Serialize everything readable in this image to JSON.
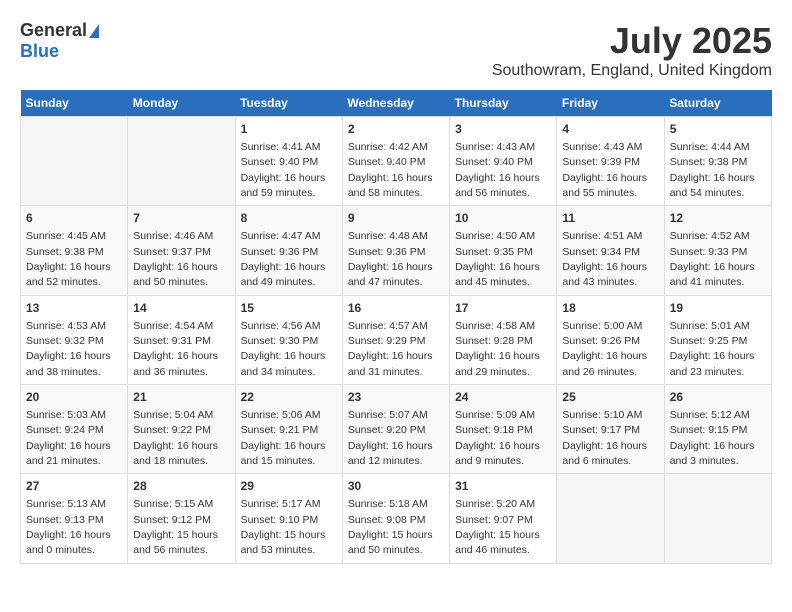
{
  "logo": {
    "general": "General",
    "blue": "Blue"
  },
  "title": "July 2025",
  "location": "Southowram, England, United Kingdom",
  "days_of_week": [
    "Sunday",
    "Monday",
    "Tuesday",
    "Wednesday",
    "Thursday",
    "Friday",
    "Saturday"
  ],
  "weeks": [
    [
      {
        "day": "",
        "info": ""
      },
      {
        "day": "",
        "info": ""
      },
      {
        "day": "1",
        "info": "Sunrise: 4:41 AM\nSunset: 9:40 PM\nDaylight: 16 hours and 59 minutes."
      },
      {
        "day": "2",
        "info": "Sunrise: 4:42 AM\nSunset: 9:40 PM\nDaylight: 16 hours and 58 minutes."
      },
      {
        "day": "3",
        "info": "Sunrise: 4:43 AM\nSunset: 9:40 PM\nDaylight: 16 hours and 56 minutes."
      },
      {
        "day": "4",
        "info": "Sunrise: 4:43 AM\nSunset: 9:39 PM\nDaylight: 16 hours and 55 minutes."
      },
      {
        "day": "5",
        "info": "Sunrise: 4:44 AM\nSunset: 9:38 PM\nDaylight: 16 hours and 54 minutes."
      }
    ],
    [
      {
        "day": "6",
        "info": "Sunrise: 4:45 AM\nSunset: 9:38 PM\nDaylight: 16 hours and 52 minutes."
      },
      {
        "day": "7",
        "info": "Sunrise: 4:46 AM\nSunset: 9:37 PM\nDaylight: 16 hours and 50 minutes."
      },
      {
        "day": "8",
        "info": "Sunrise: 4:47 AM\nSunset: 9:36 PM\nDaylight: 16 hours and 49 minutes."
      },
      {
        "day": "9",
        "info": "Sunrise: 4:48 AM\nSunset: 9:36 PM\nDaylight: 16 hours and 47 minutes."
      },
      {
        "day": "10",
        "info": "Sunrise: 4:50 AM\nSunset: 9:35 PM\nDaylight: 16 hours and 45 minutes."
      },
      {
        "day": "11",
        "info": "Sunrise: 4:51 AM\nSunset: 9:34 PM\nDaylight: 16 hours and 43 minutes."
      },
      {
        "day": "12",
        "info": "Sunrise: 4:52 AM\nSunset: 9:33 PM\nDaylight: 16 hours and 41 minutes."
      }
    ],
    [
      {
        "day": "13",
        "info": "Sunrise: 4:53 AM\nSunset: 9:32 PM\nDaylight: 16 hours and 38 minutes."
      },
      {
        "day": "14",
        "info": "Sunrise: 4:54 AM\nSunset: 9:31 PM\nDaylight: 16 hours and 36 minutes."
      },
      {
        "day": "15",
        "info": "Sunrise: 4:56 AM\nSunset: 9:30 PM\nDaylight: 16 hours and 34 minutes."
      },
      {
        "day": "16",
        "info": "Sunrise: 4:57 AM\nSunset: 9:29 PM\nDaylight: 16 hours and 31 minutes."
      },
      {
        "day": "17",
        "info": "Sunrise: 4:58 AM\nSunset: 9:28 PM\nDaylight: 16 hours and 29 minutes."
      },
      {
        "day": "18",
        "info": "Sunrise: 5:00 AM\nSunset: 9:26 PM\nDaylight: 16 hours and 26 minutes."
      },
      {
        "day": "19",
        "info": "Sunrise: 5:01 AM\nSunset: 9:25 PM\nDaylight: 16 hours and 23 minutes."
      }
    ],
    [
      {
        "day": "20",
        "info": "Sunrise: 5:03 AM\nSunset: 9:24 PM\nDaylight: 16 hours and 21 minutes."
      },
      {
        "day": "21",
        "info": "Sunrise: 5:04 AM\nSunset: 9:22 PM\nDaylight: 16 hours and 18 minutes."
      },
      {
        "day": "22",
        "info": "Sunrise: 5:06 AM\nSunset: 9:21 PM\nDaylight: 16 hours and 15 minutes."
      },
      {
        "day": "23",
        "info": "Sunrise: 5:07 AM\nSunset: 9:20 PM\nDaylight: 16 hours and 12 minutes."
      },
      {
        "day": "24",
        "info": "Sunrise: 5:09 AM\nSunset: 9:18 PM\nDaylight: 16 hours and 9 minutes."
      },
      {
        "day": "25",
        "info": "Sunrise: 5:10 AM\nSunset: 9:17 PM\nDaylight: 16 hours and 6 minutes."
      },
      {
        "day": "26",
        "info": "Sunrise: 5:12 AM\nSunset: 9:15 PM\nDaylight: 16 hours and 3 minutes."
      }
    ],
    [
      {
        "day": "27",
        "info": "Sunrise: 5:13 AM\nSunset: 9:13 PM\nDaylight: 16 hours and 0 minutes."
      },
      {
        "day": "28",
        "info": "Sunrise: 5:15 AM\nSunset: 9:12 PM\nDaylight: 15 hours and 56 minutes."
      },
      {
        "day": "29",
        "info": "Sunrise: 5:17 AM\nSunset: 9:10 PM\nDaylight: 15 hours and 53 minutes."
      },
      {
        "day": "30",
        "info": "Sunrise: 5:18 AM\nSunset: 9:08 PM\nDaylight: 15 hours and 50 minutes."
      },
      {
        "day": "31",
        "info": "Sunrise: 5:20 AM\nSunset: 9:07 PM\nDaylight: 15 hours and 46 minutes."
      },
      {
        "day": "",
        "info": ""
      },
      {
        "day": "",
        "info": ""
      }
    ]
  ]
}
